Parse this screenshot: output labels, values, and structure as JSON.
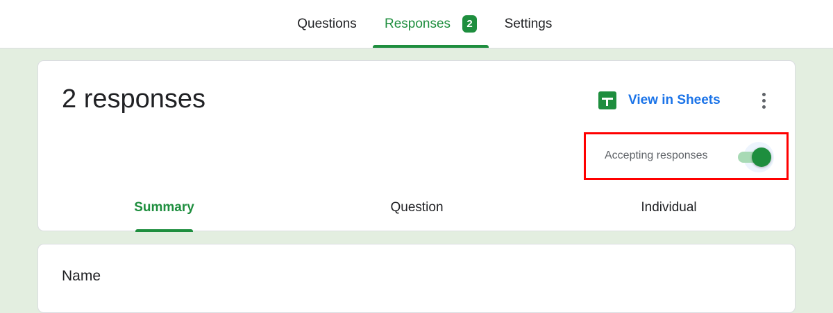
{
  "top_tabs": [
    {
      "label": "Questions"
    },
    {
      "label": "Responses",
      "badge": "2",
      "active": true
    },
    {
      "label": "Settings"
    }
  ],
  "summary": {
    "title": "2 responses",
    "view_in_sheets": "View in Sheets",
    "accepting_label": "Accepting responses",
    "accepting_on": true
  },
  "sub_tabs": [
    {
      "label": "Summary",
      "active": true
    },
    {
      "label": "Question"
    },
    {
      "label": "Individual"
    }
  ],
  "question_card": {
    "label": "Name"
  },
  "colors": {
    "accent": "#1e8e3e",
    "link": "#1a73e8",
    "background": "#e3eee0",
    "highlight": "#ff0000"
  }
}
